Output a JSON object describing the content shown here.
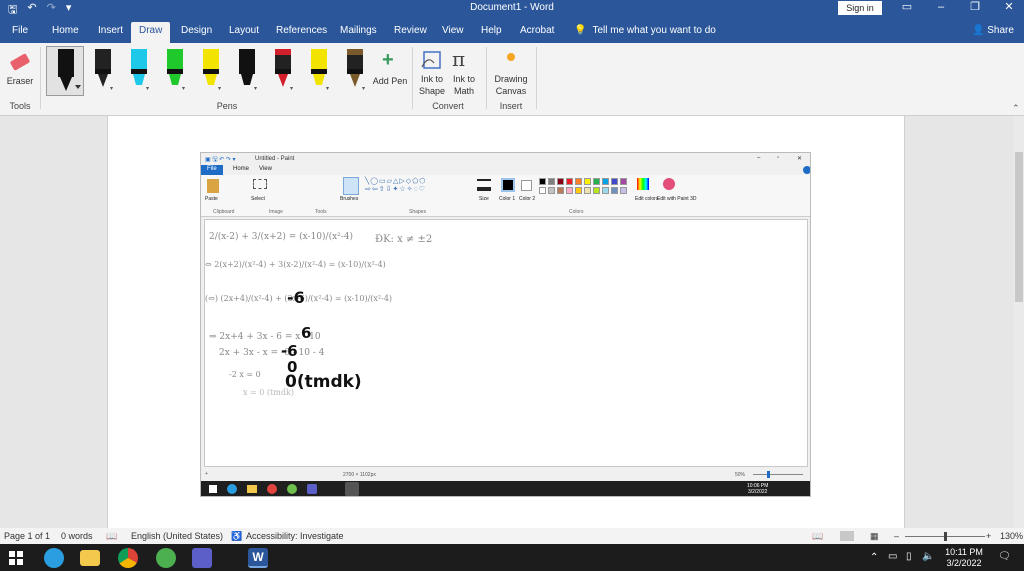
{
  "window": {
    "title": "Document1 - Word",
    "sign_in": "Sign in"
  },
  "menu": {
    "file": "File",
    "tabs": [
      "Home",
      "Insert",
      "Draw",
      "Design",
      "Layout",
      "References",
      "Mailings",
      "Review",
      "View",
      "Help",
      "Acrobat"
    ],
    "active_tab": "Draw",
    "tell_me": "Tell me what you want to do",
    "share": "Share"
  },
  "ribbon": {
    "eraser_label": "Eraser",
    "tools_group": "Tools",
    "pens_group": "Pens",
    "add_pen_label": "Add Pen",
    "ink_to_shape": "Ink to Shape",
    "ink_to_math": "Ink to Math",
    "convert_group": "Convert",
    "drawing_canvas": "Drawing Canvas",
    "insert_group": "Insert",
    "pens": [
      {
        "color": "#111111",
        "style": "marker"
      },
      {
        "color": "#222222",
        "style": "pen"
      },
      {
        "color": "#1ec8e8",
        "style": "highlighter"
      },
      {
        "color": "#1fc92b",
        "style": "highlighter"
      },
      {
        "color": "#f2e400",
        "style": "highlighter"
      },
      {
        "color": "#111111",
        "style": "highlighter"
      },
      {
        "color": "#d21f2b",
        "style": "pen"
      },
      {
        "color": "#f2e400",
        "style": "highlighter"
      },
      {
        "color": "#7a5a2a",
        "style": "pen"
      }
    ]
  },
  "paint": {
    "title": "Untitled - Paint",
    "tabs": [
      "File",
      "Home",
      "View"
    ],
    "groups": [
      "Clipboard",
      "Image",
      "Tools",
      "Shapes",
      "Colors"
    ],
    "paste": "Paste",
    "select": "Select",
    "brushes": "Brushes",
    "size": "Size",
    "color1": "Color 1",
    "color2": "Color 2",
    "edit_colors": "Edit colors",
    "edit_paint3d": "Edit with Paint 3D",
    "status_size": "2700 × 1102px",
    "status_zoom": "50%",
    "clock_time": "10:06 PM",
    "clock_date": "3/2/2022",
    "palette": [
      "#000000",
      "#7f7f7f",
      "#880015",
      "#ed1c24",
      "#ff7f27",
      "#fff200",
      "#22b14c",
      "#00a2e8",
      "#3f48cc",
      "#a349a4",
      "#ffffff",
      "#c3c3c3",
      "#b97a57",
      "#ffaec9",
      "#ffc90e",
      "#efe4b0",
      "#b5e61d",
      "#99d9ea",
      "#7092be",
      "#c8bfe7"
    ],
    "math_lines": [
      "2/(x-2) + 3/(x+2) = (x-10)/(x²-4)",
      "⇔ 2(x+2)/(x²-4) + 3(x-2)/(x²-4) = (x-10)/(x²-4)",
      "(⇔) (2x+4)/(x²-4) + (3x-6)/(x²-4) = (x-10)/(x²-4)",
      "⇒ 2x+4 + 3x - 6 = x - 10",
      "2x + 3x - x = -6 - 10 - 4",
      "-2 x  = 0",
      "x = 0 (tmdk)"
    ],
    "condition": "ĐK: x ≠ ±2",
    "bold_marks": [
      "-6",
      "6",
      "-6",
      "0",
      "0(tmdk)"
    ]
  },
  "status": {
    "page": "Page 1 of 1",
    "words": "0 words",
    "language": "English (United States)",
    "accessibility": "Accessibility: Investigate",
    "zoom": "130%"
  },
  "taskbar": {
    "time": "10:11 PM",
    "date": "3/2/2022",
    "apps": [
      "windows-start",
      "edge",
      "file-explorer",
      "chrome",
      "green-app",
      "teams",
      "word"
    ]
  }
}
